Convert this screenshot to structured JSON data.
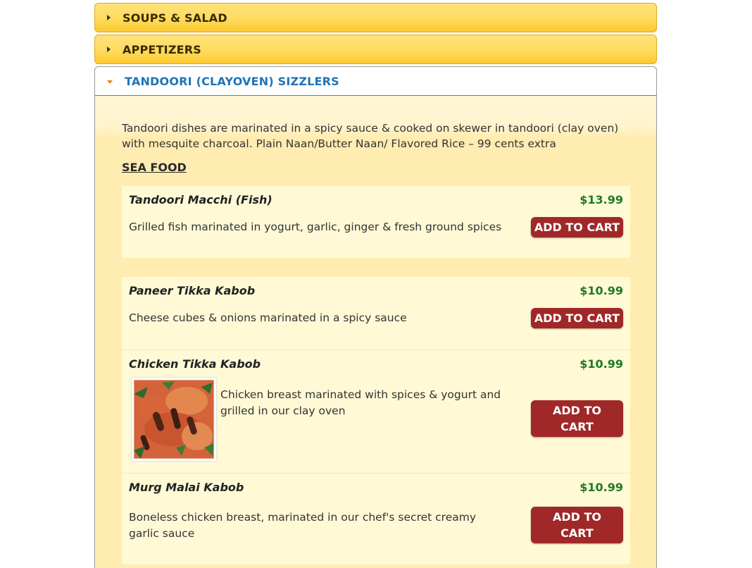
{
  "accordion": {
    "sections": [
      {
        "title": "SOUPS & SALAD"
      },
      {
        "title": "APPETIZERS"
      },
      {
        "title": "TANDOORI (CLAYOVEN) SIZZLERS"
      }
    ]
  },
  "tandoori": {
    "intro": "Tandoori dishes are marinated in a spicy sauce & cooked on skewer in tandoori (clay oven) with mesquite charcoal. Plain Naan/Butter Naan/ Flavored Rice – 99 cents extra",
    "section_title": "SEA FOOD",
    "items": [
      {
        "name": "Tandoori Macchi (Fish)",
        "price": "$13.99",
        "description": "Grilled fish marinated in yogurt, garlic, ginger & fresh ground spices",
        "button": "ADD TO CART"
      },
      {
        "name": "Paneer Tikka Kabob",
        "price": "$10.99",
        "description": "Cheese cubes & onions marinated in a spicy sauce",
        "button": "ADD TO CART"
      },
      {
        "name": "Chicken Tikka Kabob",
        "price": "$10.99",
        "description": "Chicken breast marinated with spices & yogurt and grilled in our clay oven",
        "button": "ADD TO CART"
      },
      {
        "name": "Murg Malai Kabob",
        "price": "$10.99",
        "description": "Boneless chicken breast, marinated in our chef's secret creamy garlic sauce",
        "button": "ADD TO CART"
      }
    ]
  },
  "colors": {
    "header_gold": "#fedb5e",
    "active_title": "#1f73b7",
    "price_green": "#1e7a28",
    "button_red": "#a02828"
  }
}
